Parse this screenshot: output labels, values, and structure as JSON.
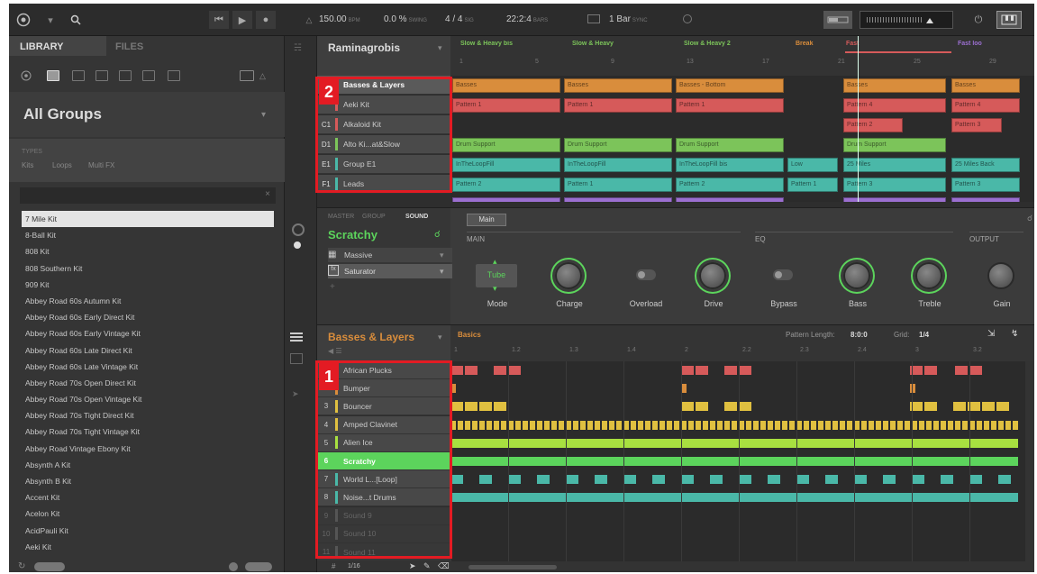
{
  "colors": {
    "accent": "#5cd45c",
    "callout": "#e31b23",
    "orange": "#d98d3c",
    "red": "#d65a5a",
    "green": "#7cc45a",
    "teal": "#4ab8a8",
    "purple": "#9b6fd0",
    "yellow": "#e0c040",
    "lime": "#a8e040"
  },
  "topbar": {
    "tempo": "150.00",
    "tempo_unit": "BPM",
    "swing": "0.0 %",
    "swing_unit": "SWING",
    "sig": "4 / 4",
    "sig_unit": "SIG",
    "position": "22:2:4",
    "position_unit": "BARS",
    "quantize": "1 Bar",
    "quantize_unit": "SYNC"
  },
  "browser": {
    "tab_library": "LIBRARY",
    "tab_files": "FILES",
    "group_title": "All Groups",
    "types_label": "TYPES",
    "types": [
      "Kits",
      "Loops",
      "Multi FX"
    ],
    "items": [
      "7 Mile Kit",
      "8-Ball Kit",
      "808 Kit",
      "808 Southern Kit",
      "909 Kit",
      "Abbey Road 60s Autumn Kit",
      "Abbey Road 60s Early Direct Kit",
      "Abbey Road 60s Early Vintage Kit",
      "Abbey Road 60s Late Direct Kit",
      "Abbey Road 60s Late Vintage Kit",
      "Abbey Road 70s Open Direct Kit",
      "Abbey Road 70s Open Vintage Kit",
      "Abbey Road 70s Tight Direct Kit",
      "Abbey Road 70s Tight Vintage Kit",
      "Abbey Road Vintage Ebony Kit",
      "Absynth A Kit",
      "Absynth B Kit",
      "Accent Kit",
      "Acelon Kit",
      "AcidPauli Kit",
      "Aeki Kit"
    ]
  },
  "arranger": {
    "project": "Raminagrobis",
    "scenes": [
      "Slow & Heavy bis",
      "Slow & Heavy",
      "Slow & Heavy 2",
      "Break",
      "Fast",
      "Fast loo"
    ],
    "ruler": [
      "1",
      "5",
      "9",
      "13",
      "17",
      "21",
      "25",
      "29"
    ],
    "groups": [
      {
        "letter": "",
        "name": "Basses & Layers",
        "color": "#d98d3c"
      },
      {
        "letter": "",
        "name": "Aeki Kit",
        "color": "#d65a5a"
      },
      {
        "letter": "C1",
        "name": "Alkaloid Kit",
        "color": "#d65a5a"
      },
      {
        "letter": "D1",
        "name": "Alto Ki...at&Slow",
        "color": "#7cc45a"
      },
      {
        "letter": "E1",
        "name": "Group E1",
        "color": "#4ab8a8"
      },
      {
        "letter": "F1",
        "name": "Leads",
        "color": "#4ab8a8"
      }
    ],
    "clips": {
      "basses": "Basses",
      "basses_bottom": "Basses - Bottom",
      "pattern1": "Pattern 1",
      "pattern4": "Pattern 4",
      "pattern2": "Pattern 2",
      "pattern3": "Pattern 3",
      "drum_support": "Drum Support",
      "intro_loop": "InTheLoopFill",
      "intro_loop_bis": "InTheLoopFill bis",
      "low": "Low",
      "miles": "25 Miles",
      "miles_back": "25 Miles Back"
    }
  },
  "control": {
    "tabs": [
      "MASTER",
      "GROUP",
      "SOUND"
    ],
    "main_tab": "Main",
    "sound_name": "Scratchy",
    "plugins": [
      "Massive",
      "Saturator"
    ],
    "sections": [
      "MAIN",
      "EQ",
      "OUTPUT"
    ],
    "mode_value": "Tube",
    "labels": [
      "Mode",
      "Charge",
      "Overload",
      "Drive",
      "Bypass",
      "Bass",
      "Treble",
      "Gain"
    ]
  },
  "pattern": {
    "group": "Basses & Layers",
    "pattern_name": "Basics",
    "length_label": "Pattern Length:",
    "length": "8:0:0",
    "grid_label": "Grid:",
    "grid": "1/4",
    "ruler": [
      "1",
      "1.2",
      "1.3",
      "1.4",
      "2",
      "2.2",
      "2.3",
      "2.4",
      "3",
      "3.2"
    ],
    "sounds": [
      {
        "num": "1",
        "name": "African Plucks",
        "color": "#d65a5a"
      },
      {
        "num": "2",
        "name": "Bumper",
        "color": "#d98d3c"
      },
      {
        "num": "3",
        "name": "Bouncer",
        "color": "#e0c040"
      },
      {
        "num": "4",
        "name": "Amped Clavinet",
        "color": "#e0c040"
      },
      {
        "num": "5",
        "name": "Alien Ice",
        "color": "#a8e040"
      },
      {
        "num": "6",
        "name": "Scratchy",
        "color": "#5cd45c"
      },
      {
        "num": "7",
        "name": "World L...[Loop]",
        "color": "#4ab8a8"
      },
      {
        "num": "8",
        "name": "Noise...t Drums",
        "color": "#4ab8a8"
      },
      {
        "num": "9",
        "name": "Sound 9",
        "color": "#555"
      },
      {
        "num": "10",
        "name": "Sound 10",
        "color": "#555"
      },
      {
        "num": "11",
        "name": "Sound 11",
        "color": "#555"
      }
    ],
    "step_label": "1/16"
  },
  "callouts": {
    "one": "1",
    "two": "2"
  }
}
